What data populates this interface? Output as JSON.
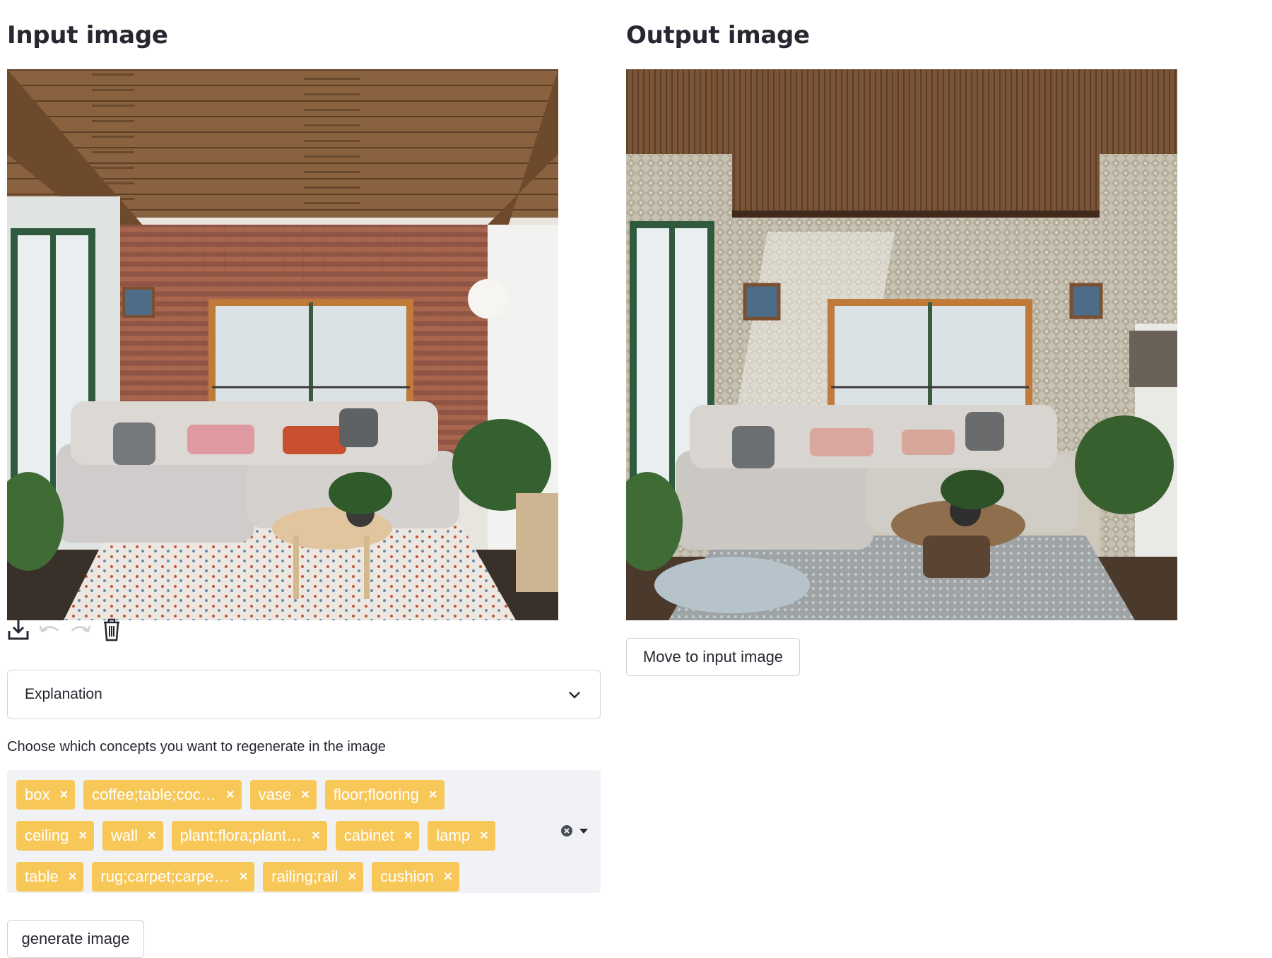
{
  "input": {
    "heading": "Input image",
    "toolbar": {
      "download_icon": "download-icon",
      "undo_icon": "undo-icon",
      "redo_icon": "redo-icon",
      "delete_icon": "trash-icon"
    }
  },
  "output": {
    "heading": "Output image",
    "move_button": "Move to input image"
  },
  "explanation": {
    "label": "Explanation",
    "icon": "chevron-down-icon"
  },
  "concepts": {
    "caption": "Choose which concepts you want to regenerate in the image",
    "rows": [
      [
        "box",
        "coffee;table;coc…",
        "vase",
        "floor;flooring"
      ],
      [
        "ceiling",
        "wall",
        "plant;flora;plant…",
        "cabinet",
        "lamp"
      ],
      [
        "table",
        "rug;carpet;carpe…",
        "railing;rail",
        "cushion"
      ]
    ],
    "remove_symbol": "×",
    "tag_color": "#f7c858"
  },
  "generate_button": "generate image"
}
